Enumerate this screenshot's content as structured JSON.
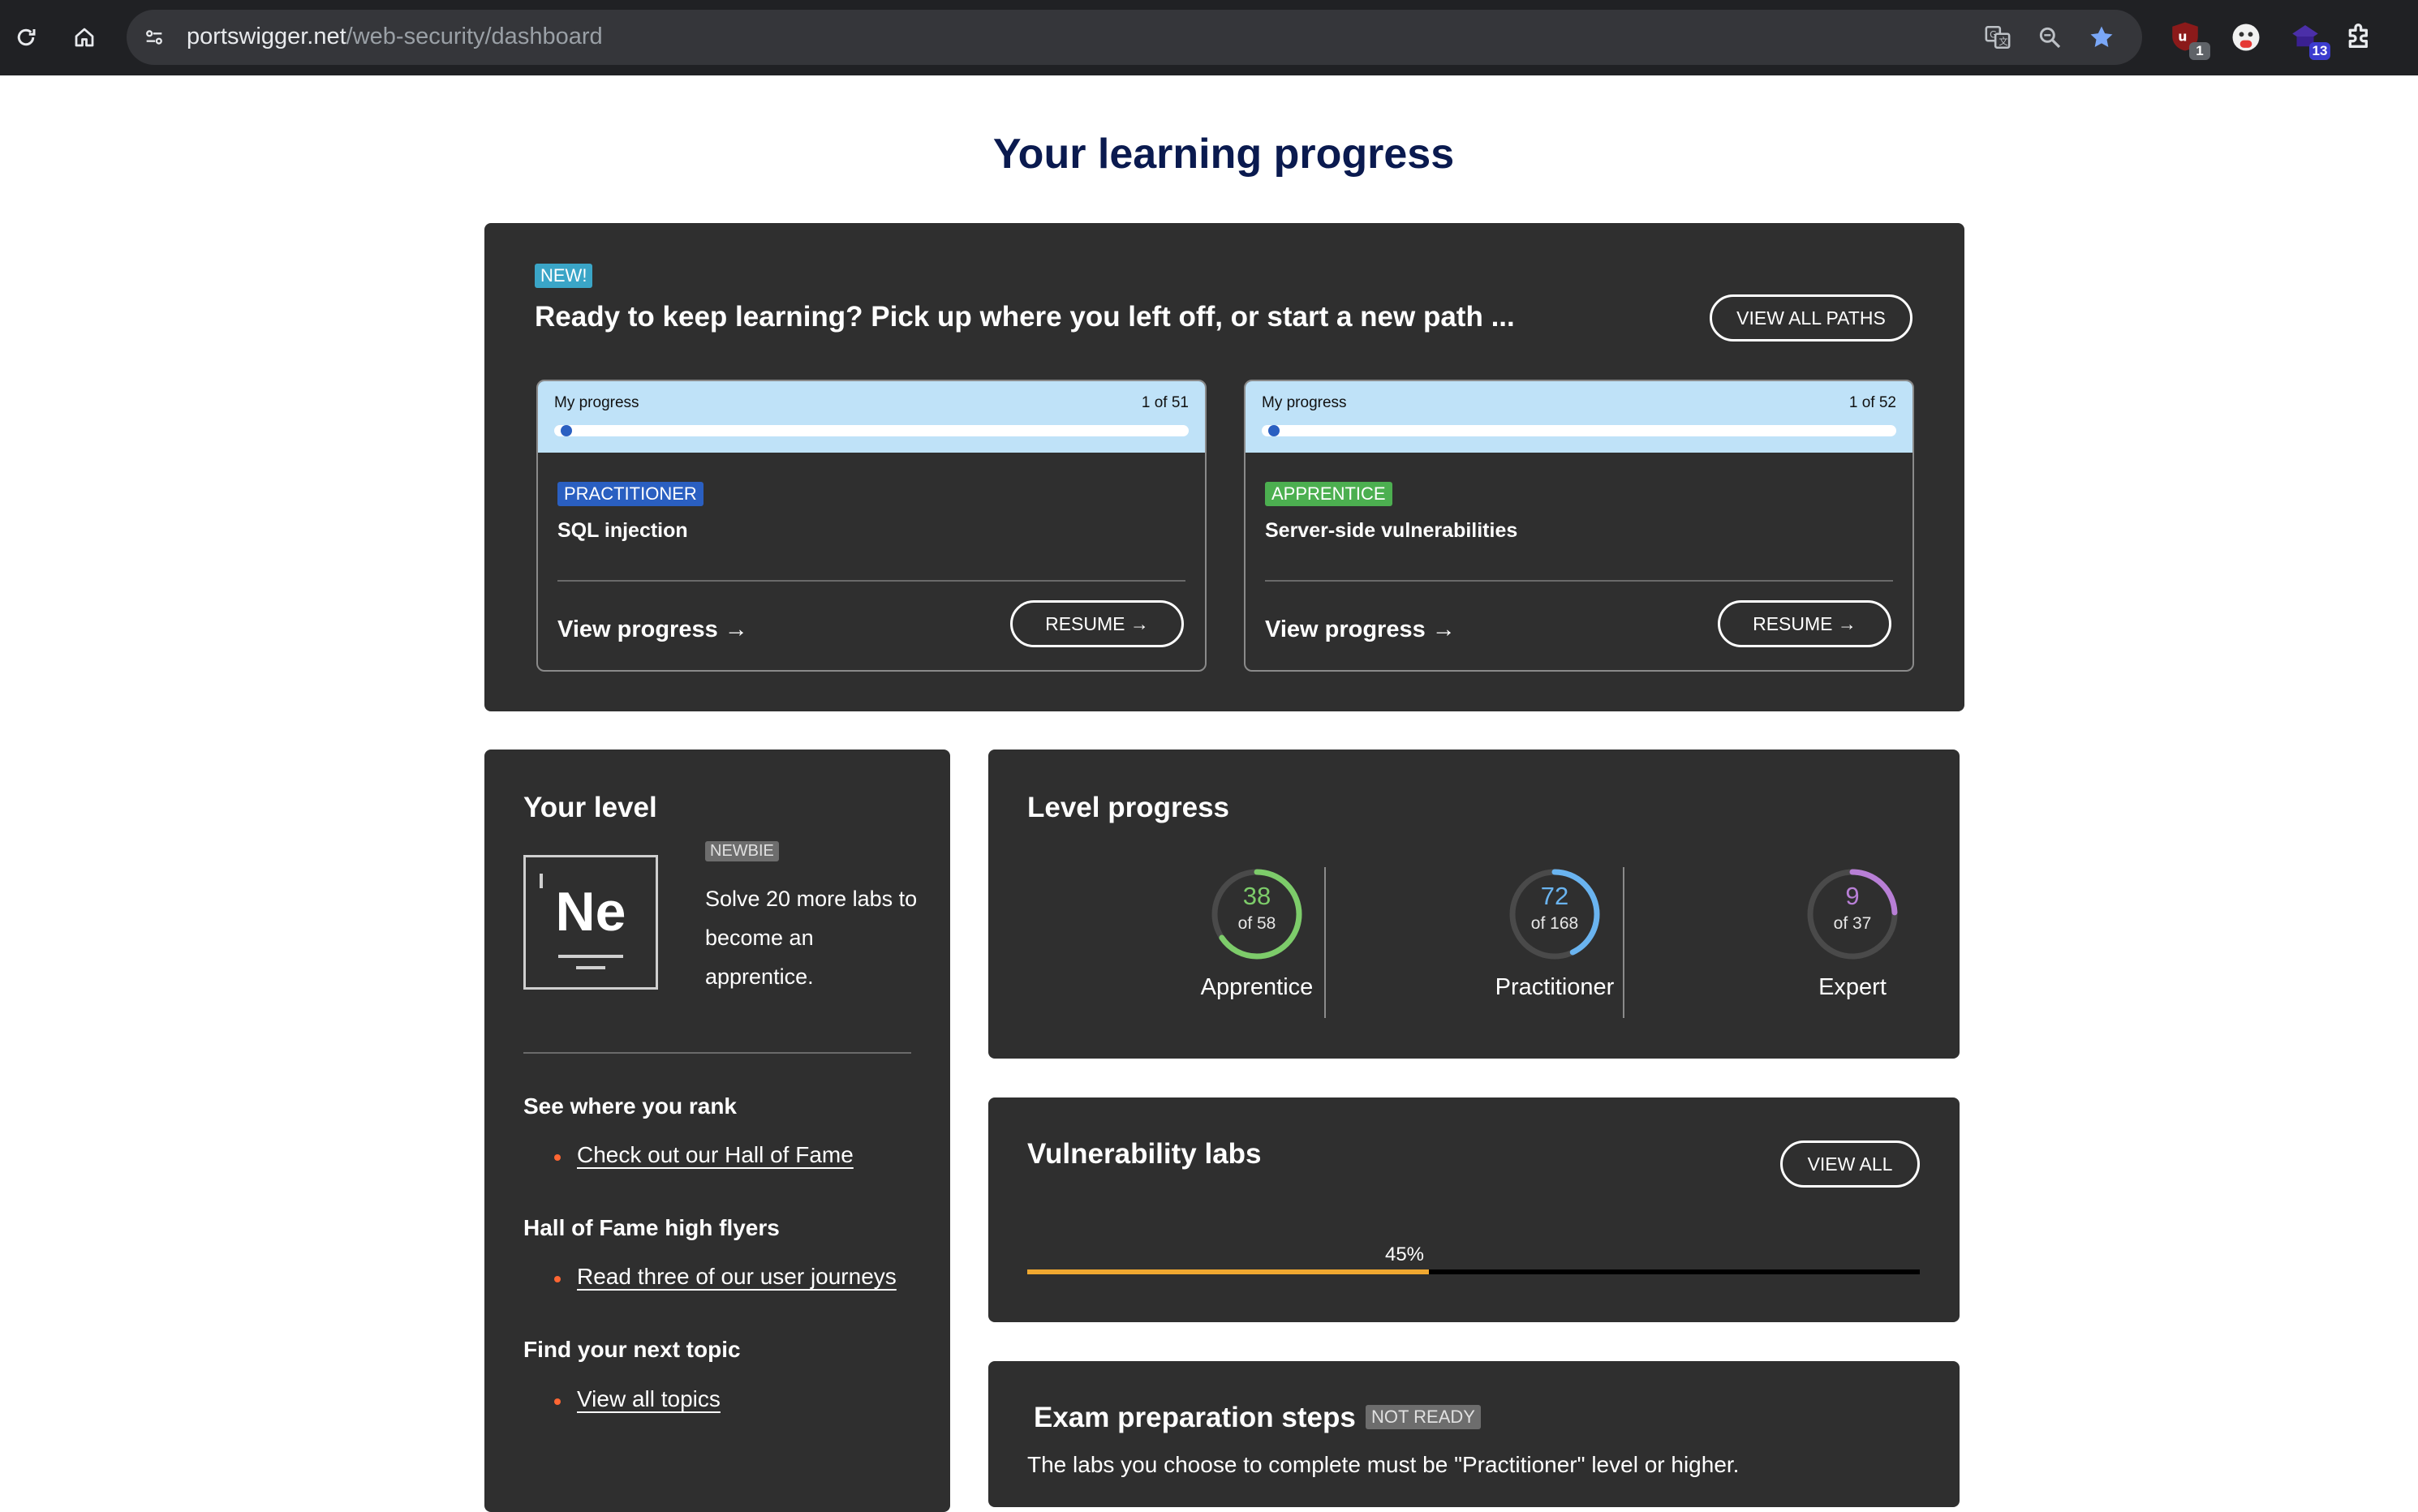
{
  "browser": {
    "url_host": "portswigger.net",
    "url_path": "/web-security/dashboard",
    "extension_badges": [
      "1",
      "13"
    ]
  },
  "page": {
    "title": "Your learning progress"
  },
  "hero": {
    "new_tag": "NEW!",
    "title": "Ready to keep learning? Pick up where you left off, or start a new path ...",
    "view_all_paths": "VIEW ALL PATHS",
    "paths": [
      {
        "progress_label": "My progress",
        "count": "1 of 51",
        "progress_fraction": 0.0196,
        "level": "PRACTITIONER",
        "level_color": "#2a5fc1",
        "name": "SQL injection",
        "view_progress": "View progress →",
        "resume": "RESUME →"
      },
      {
        "progress_label": "My progress",
        "count": "1 of 52",
        "progress_fraction": 0.0192,
        "level": "APPRENTICE",
        "level_color": "#4caf50",
        "name": "Server-side vulnerabilities",
        "view_progress": "View progress →",
        "resume": "RESUME →"
      }
    ]
  },
  "your_level": {
    "title": "Your level",
    "symbol": "Ne",
    "tag": "NEWBIE",
    "text": "Solve 20 more labs to become an apprentice.",
    "sections": [
      {
        "heading": "See where you rank",
        "link": "Check out our Hall of Fame"
      },
      {
        "heading": "Hall of Fame high flyers",
        "link": "Read three of our user journeys"
      },
      {
        "heading": "Find your next topic",
        "link": "View all topics"
      }
    ]
  },
  "level_progress": {
    "title": "Level progress",
    "levels": [
      {
        "value": "38",
        "of": "of 58",
        "label": "Apprentice",
        "fraction": 0.655,
        "color": "#7dcc6a"
      },
      {
        "value": "72",
        "of": "of 168",
        "label": "Practitioner",
        "fraction": 0.429,
        "color": "#6ab4f0"
      },
      {
        "value": "9",
        "of": "of 37",
        "label": "Expert",
        "fraction": 0.243,
        "color": "#b87fd6"
      }
    ]
  },
  "vuln_labs": {
    "title": "Vulnerability labs",
    "view_all": "VIEW ALL",
    "percent_label": "45%",
    "percent": 45
  },
  "exam": {
    "title": "Exam preparation steps",
    "tag": "NOT READY",
    "text": "The labs you choose to complete must be \"Practitioner\" level or higher."
  },
  "colors": {
    "panel": "#2f2f2f",
    "title": "#0a1a4f",
    "accent_orange": "#f0a830",
    "bullet": "#ff6633"
  }
}
